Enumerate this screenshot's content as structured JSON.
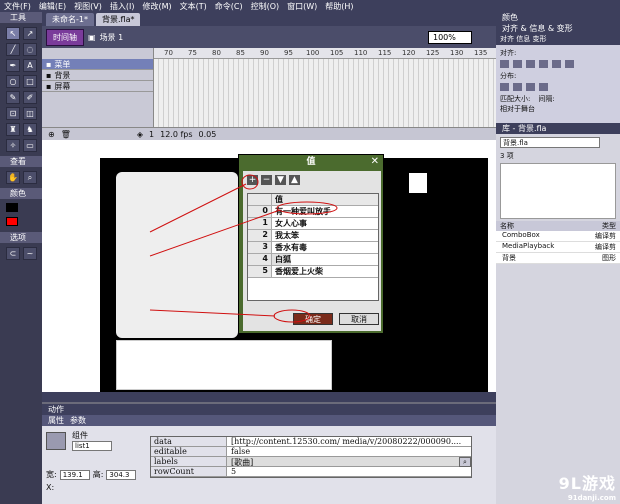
{
  "menu": [
    "文件(F)",
    "编辑(E)",
    "视图(V)",
    "插入(I)",
    "修改(M)",
    "文本(T)",
    "命令(C)",
    "控制(O)",
    "窗口(W)",
    "帮助(H)"
  ],
  "tabs": [
    "未命名-1*",
    "背景.fla*"
  ],
  "toolbox": {
    "title": "工具",
    "view_title": "查看",
    "color_title": "颜色",
    "options_title": "选项"
  },
  "editbar": {
    "button": "时间轴",
    "scene": "场景 1",
    "zoom": "100%"
  },
  "timeline": {
    "layers": [
      {
        "name": "菜单",
        "selected": true
      },
      {
        "name": "背景",
        "selected": false
      },
      {
        "name": "屏幕",
        "selected": false
      }
    ],
    "ruler": [
      "70",
      "75",
      "80",
      "85",
      "90",
      "95",
      "100",
      "105",
      "110",
      "115",
      "120",
      "125",
      "130",
      "135"
    ],
    "frame": "1",
    "fps": "12.0 fps",
    "time": "0.05"
  },
  "dialog": {
    "title": "值",
    "header": "值",
    "rows": [
      {
        "index": "0",
        "value": "有一种爱叫放手"
      },
      {
        "index": "1",
        "value": "女人心事"
      },
      {
        "index": "2",
        "value": "我太笨"
      },
      {
        "index": "3",
        "value": "香水有毒"
      },
      {
        "index": "4",
        "value": "白狐"
      },
      {
        "index": "5",
        "value": "香烟爱上火柴"
      }
    ],
    "ok": "确定",
    "cancel": "取消"
  },
  "right": {
    "color_panel": "颜色",
    "align_tabs": "对齐 信息 变形",
    "align_title": "对齐 & 信息 & 变形",
    "align_label": "对齐:",
    "distribute_label": "分布:",
    "match_label": "匹配大小:",
    "spacing_label": "间隔:",
    "relative_label": "相对于舞台",
    "library_title": "库 - 背景.fla",
    "library_select": "背景.fla",
    "library_count": "3 项",
    "library_cols": [
      "名称",
      "类型"
    ],
    "library_items": [
      {
        "name": "ComboBox",
        "type": "编译剪"
      },
      {
        "name": "MediaPlayback",
        "type": "编译剪"
      },
      {
        "name": "背景",
        "type": "图形"
      }
    ]
  },
  "props": {
    "tabs": [
      "动作",
      "属性",
      "参数"
    ],
    "component_label": "组件",
    "instance_name": "list1",
    "width_label": "宽:",
    "width": "139.1",
    "height_label": "高:",
    "height": "304.3",
    "x_label": "X:",
    "rows": [
      {
        "k": "data",
        "v": "[http://content.12530.com/ media/v/20080222/000090...."
      },
      {
        "k": "editable",
        "v": "false"
      },
      {
        "k": "labels",
        "v": "[歌曲]"
      },
      {
        "k": "rowCount",
        "v": "5"
      }
    ]
  },
  "watermark": {
    "main": "9L游戏",
    "sub": "91danji.com"
  }
}
